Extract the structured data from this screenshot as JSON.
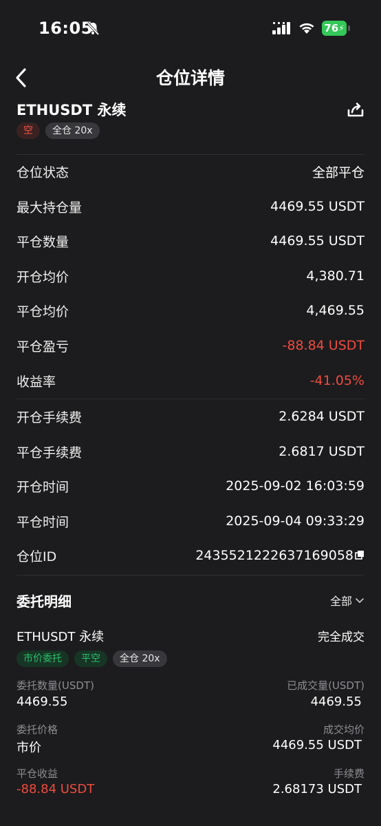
{
  "status_bar": {
    "time": "16:05",
    "battery": "76"
  },
  "nav": {
    "title": "仓位详情"
  },
  "position": {
    "pair": "ETHUSDT 永续",
    "side_tag": "空",
    "margin_tag": "全仓 20x"
  },
  "details": [
    {
      "label": "仓位状态",
      "value": "全部平仓"
    },
    {
      "label": "最大持仓量",
      "value": "4469.55 USDT"
    },
    {
      "label": "平仓数量",
      "value": "4469.55 USDT"
    },
    {
      "label": "开仓均价",
      "value": "4,380.71"
    },
    {
      "label": "平仓均价",
      "value": "4,469.55"
    },
    {
      "label": "平仓盈亏",
      "value": "-88.84 USDT"
    },
    {
      "label": "收益率",
      "value": "-41.05%"
    },
    {
      "label": "开仓手续费",
      "value": "2.6284 USDT"
    },
    {
      "label": "平仓手续费",
      "value": "2.6817 USDT"
    },
    {
      "label": "开仓时间",
      "value": "2025-09-02 16:03:59"
    },
    {
      "label": "平仓时间",
      "value": "2025-09-04 09:33:29"
    },
    {
      "label": "仓位ID",
      "value": "2435521222637169058"
    }
  ],
  "orders": {
    "title": "委托明细",
    "filter": "全部",
    "item": {
      "pair": "ETHUSDT 永续",
      "status": "完全成交",
      "tags": [
        "市价委托",
        "平空",
        "全仓 20x"
      ],
      "order_qty_label": "委托数量(USDT)",
      "order_qty": "4469.55",
      "filled_qty_label": "已成交量(USDT)",
      "filled_qty": "4469.55",
      "order_price_label": "委托价格",
      "order_price": "市价",
      "avg_price_label": "成交均价",
      "avg_price": "4469.55 USDT",
      "pnl_label": "平仓收益",
      "pnl": "-88.84 USDT",
      "fee_label": "手续费",
      "fee": "2.68173 USDT"
    }
  },
  "colors": {
    "background": "#1c1c1e",
    "loss": "#f04b3e",
    "green": "#2bbf6a",
    "battery": "#34c759"
  }
}
